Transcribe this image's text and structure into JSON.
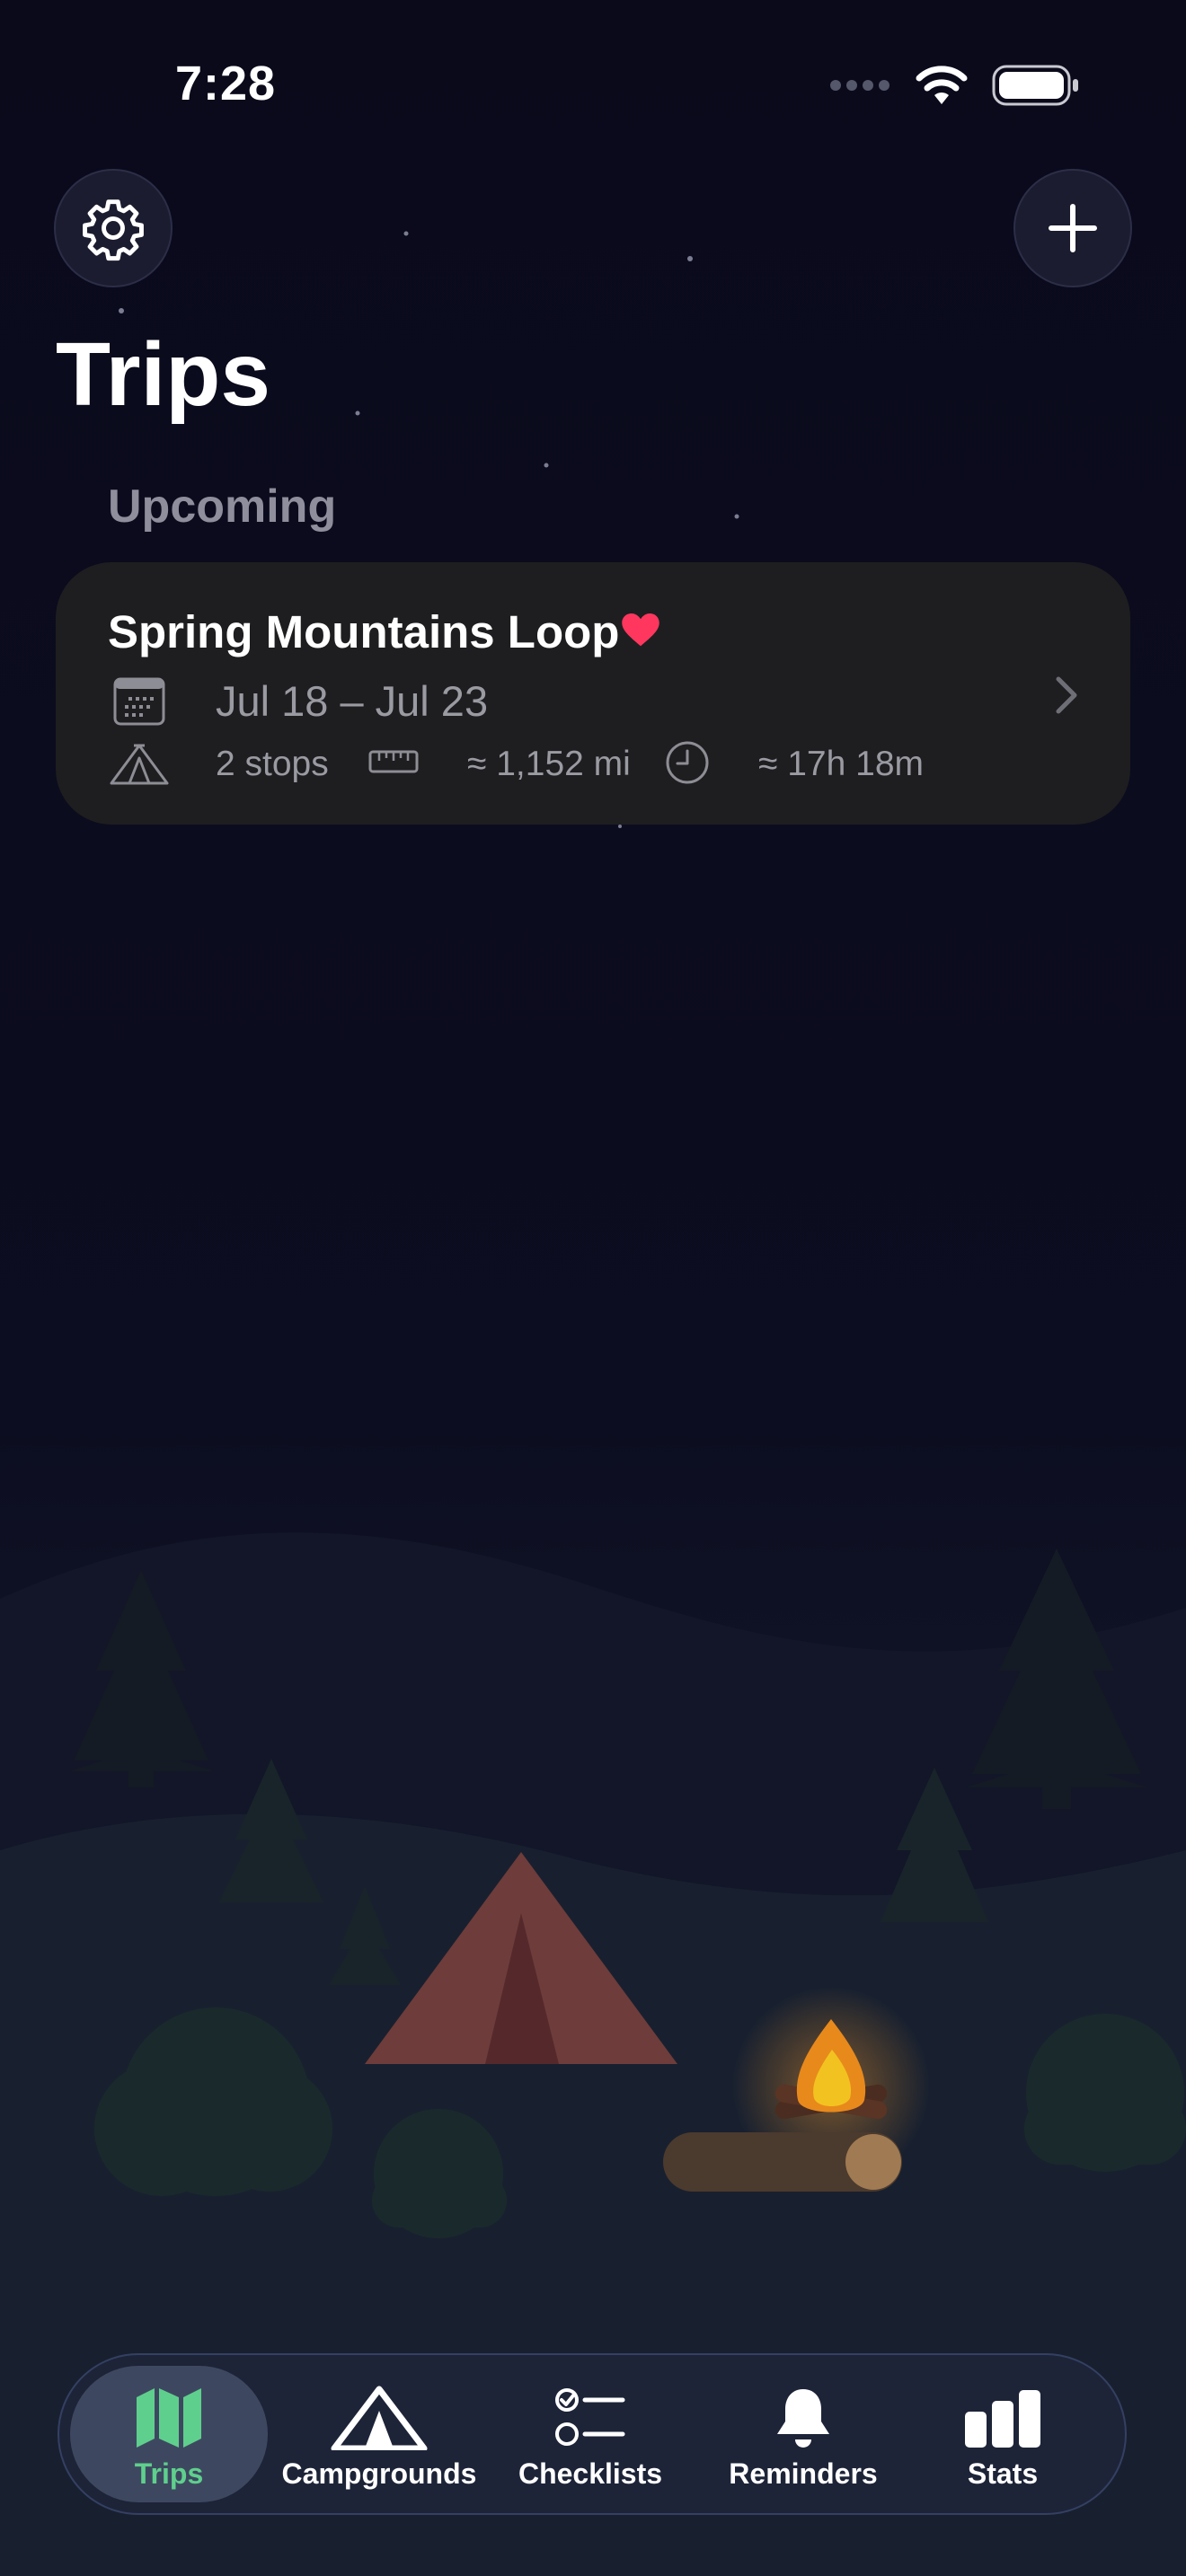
{
  "status_bar": {
    "time": "7:28"
  },
  "header": {
    "settings_icon": "gear-icon",
    "add_icon": "plus-icon",
    "title": "Trips"
  },
  "sections": [
    {
      "label": "Upcoming",
      "trips": [
        {
          "name": "Spring Mountains Loop",
          "favorite": true,
          "dates": "Jul 18 – Jul 23",
          "stops": "2 stops",
          "distance": "≈ 1,152 mi",
          "duration": "≈ 17h 18m"
        }
      ]
    }
  ],
  "tabbar": {
    "tabs": [
      {
        "label": "Trips",
        "icon": "map-icon",
        "active": true
      },
      {
        "label": "Campgrounds",
        "icon": "tent-icon",
        "active": false
      },
      {
        "label": "Checklists",
        "icon": "checklist-icon",
        "active": false
      },
      {
        "label": "Reminders",
        "icon": "bell-icon",
        "active": false
      },
      {
        "label": "Stats",
        "icon": "bar-chart-icon",
        "active": false
      }
    ]
  },
  "colors": {
    "background": "#0b0b1c",
    "card": "#1e1e20",
    "accent_green": "#5fcf8d",
    "heart": "#ff375f",
    "tent": "#7a4340",
    "fire": "#f0a31c"
  }
}
